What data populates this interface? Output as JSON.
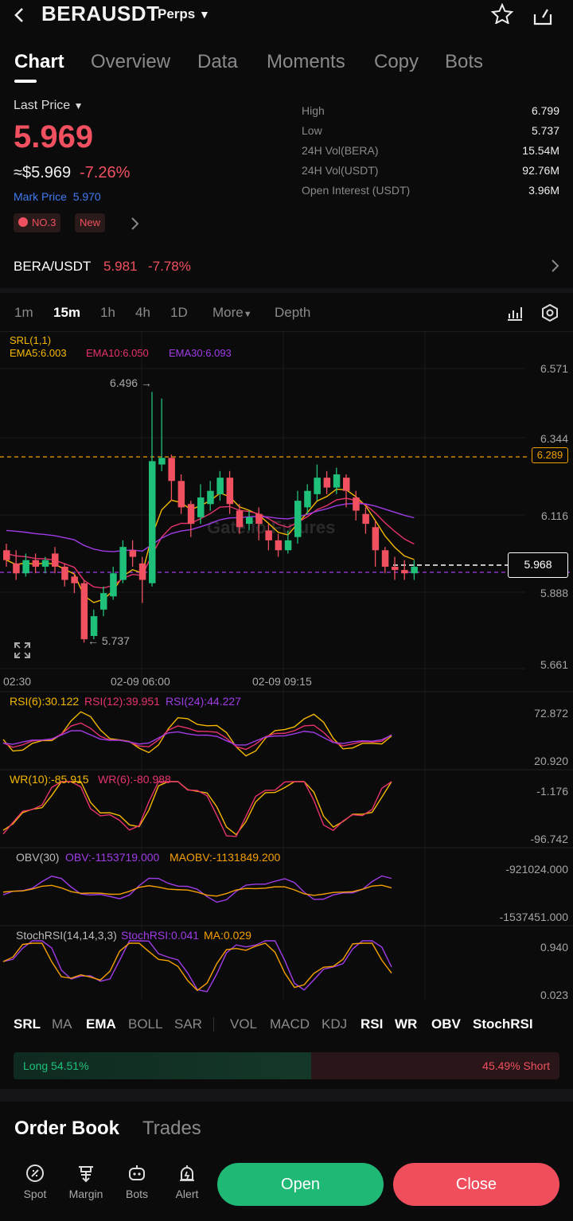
{
  "header": {
    "back_icon": "chevron-left-icon",
    "symbol": "BERAUSDT",
    "market_type": "Perps",
    "star_icon": "star-icon",
    "share_icon": "share-icon"
  },
  "tabs": [
    {
      "label": "Chart",
      "active": true
    },
    {
      "label": "Overview"
    },
    {
      "label": "Data"
    },
    {
      "label": "Moments"
    },
    {
      "label": "Copy"
    },
    {
      "label": "Bots"
    }
  ],
  "price": {
    "label": "Last Price",
    "last": "5.969",
    "usd_approx": "≈$5.969",
    "change_pct": "-7.26%",
    "mark_label": "Mark Price",
    "mark_value": "5.970",
    "rank_badge": "NO.3",
    "new_badge": "New"
  },
  "stats": [
    {
      "label": "High",
      "value": "6.799"
    },
    {
      "label": "Low",
      "value": "5.737"
    },
    {
      "label": "24H Vol(BERA)",
      "value": "15.54M"
    },
    {
      "label": "24H Vol(USDT)",
      "value": "92.76M"
    },
    {
      "label": "Open Interest (USDT)",
      "value": "3.96M"
    }
  ],
  "spot": {
    "pair": "BERA/USDT",
    "price": "5.981",
    "change": "-7.78%"
  },
  "timeframes": [
    {
      "label": "1m"
    },
    {
      "label": "15m",
      "active": true
    },
    {
      "label": "1h"
    },
    {
      "label": "4h"
    },
    {
      "label": "1D"
    },
    {
      "label": "More"
    },
    {
      "label": "Depth"
    }
  ],
  "main_chart": {
    "srl": "SRL(1,1)",
    "ema5": "EMA5:6.003",
    "ema10": "EMA10:6.050",
    "ema30": "EMA30:6.093",
    "yticks": [
      "6.571",
      "6.344",
      "6.116",
      "5.888",
      "5.661"
    ],
    "high_marker": "6.496 →",
    "low_marker": "← 5.737",
    "srl_level": "6.289",
    "current_price": "5.968",
    "watermark": "Gate.io Futures",
    "xticks": [
      "02:30",
      "02-09 06:00",
      "02-09 09:15"
    ]
  },
  "rsi": {
    "l1": "RSI(6):30.122",
    "l2": "RSI(12):39.951",
    "l3": "RSI(24):44.227",
    "top": "72.872",
    "bottom": "20.920"
  },
  "wr": {
    "l1": "WR(10):-85.915",
    "l2": "WR(6):-80.988",
    "top": "-1.176",
    "bottom": "-96.742"
  },
  "obv": {
    "l1": "OBV(30)",
    "l2": "OBV:-1153719.000",
    "l3": "MAOBV:-1131849.200",
    "top": "-921024.000",
    "bottom": "-1537451.000"
  },
  "stochrsi": {
    "l1": "StochRSI(14,14,3,3)",
    "l2": "StochRSI:0.041",
    "l3": "MA:0.029",
    "top": "0.940",
    "bottom": "0.023"
  },
  "indicator_tabs": [
    {
      "label": "SRL",
      "on": true
    },
    {
      "label": "MA"
    },
    {
      "label": "EMA",
      "on": true
    },
    {
      "label": "BOLL"
    },
    {
      "label": "SAR"
    },
    {
      "label": "VOL"
    },
    {
      "label": "MACD"
    },
    {
      "label": "KDJ"
    },
    {
      "label": "RSI",
      "on": true
    },
    {
      "label": "WR",
      "on": true
    },
    {
      "label": "OBV",
      "on": true
    },
    {
      "label": "StochRSI",
      "on": true
    }
  ],
  "long_short": {
    "long": "Long 54.51%",
    "short": "45.49% Short",
    "long_fraction": 0.5451
  },
  "orderbook": {
    "title": "Order Book",
    "trades": "Trades"
  },
  "bottom_nav": [
    {
      "label": "Spot",
      "icon": "spot-icon"
    },
    {
      "label": "Margin",
      "icon": "margin-icon"
    },
    {
      "label": "Bots",
      "icon": "bots-icon"
    },
    {
      "label": "Alert",
      "icon": "alert-icon"
    }
  ],
  "actions": {
    "open": "Open",
    "close": "Close"
  },
  "colors": {
    "up": "#1fc17a",
    "down": "#f0505f",
    "ema5": "#f5b800",
    "ema10": "#e6336b",
    "ema30": "#a03ce6",
    "accent": "#f0a100"
  }
}
